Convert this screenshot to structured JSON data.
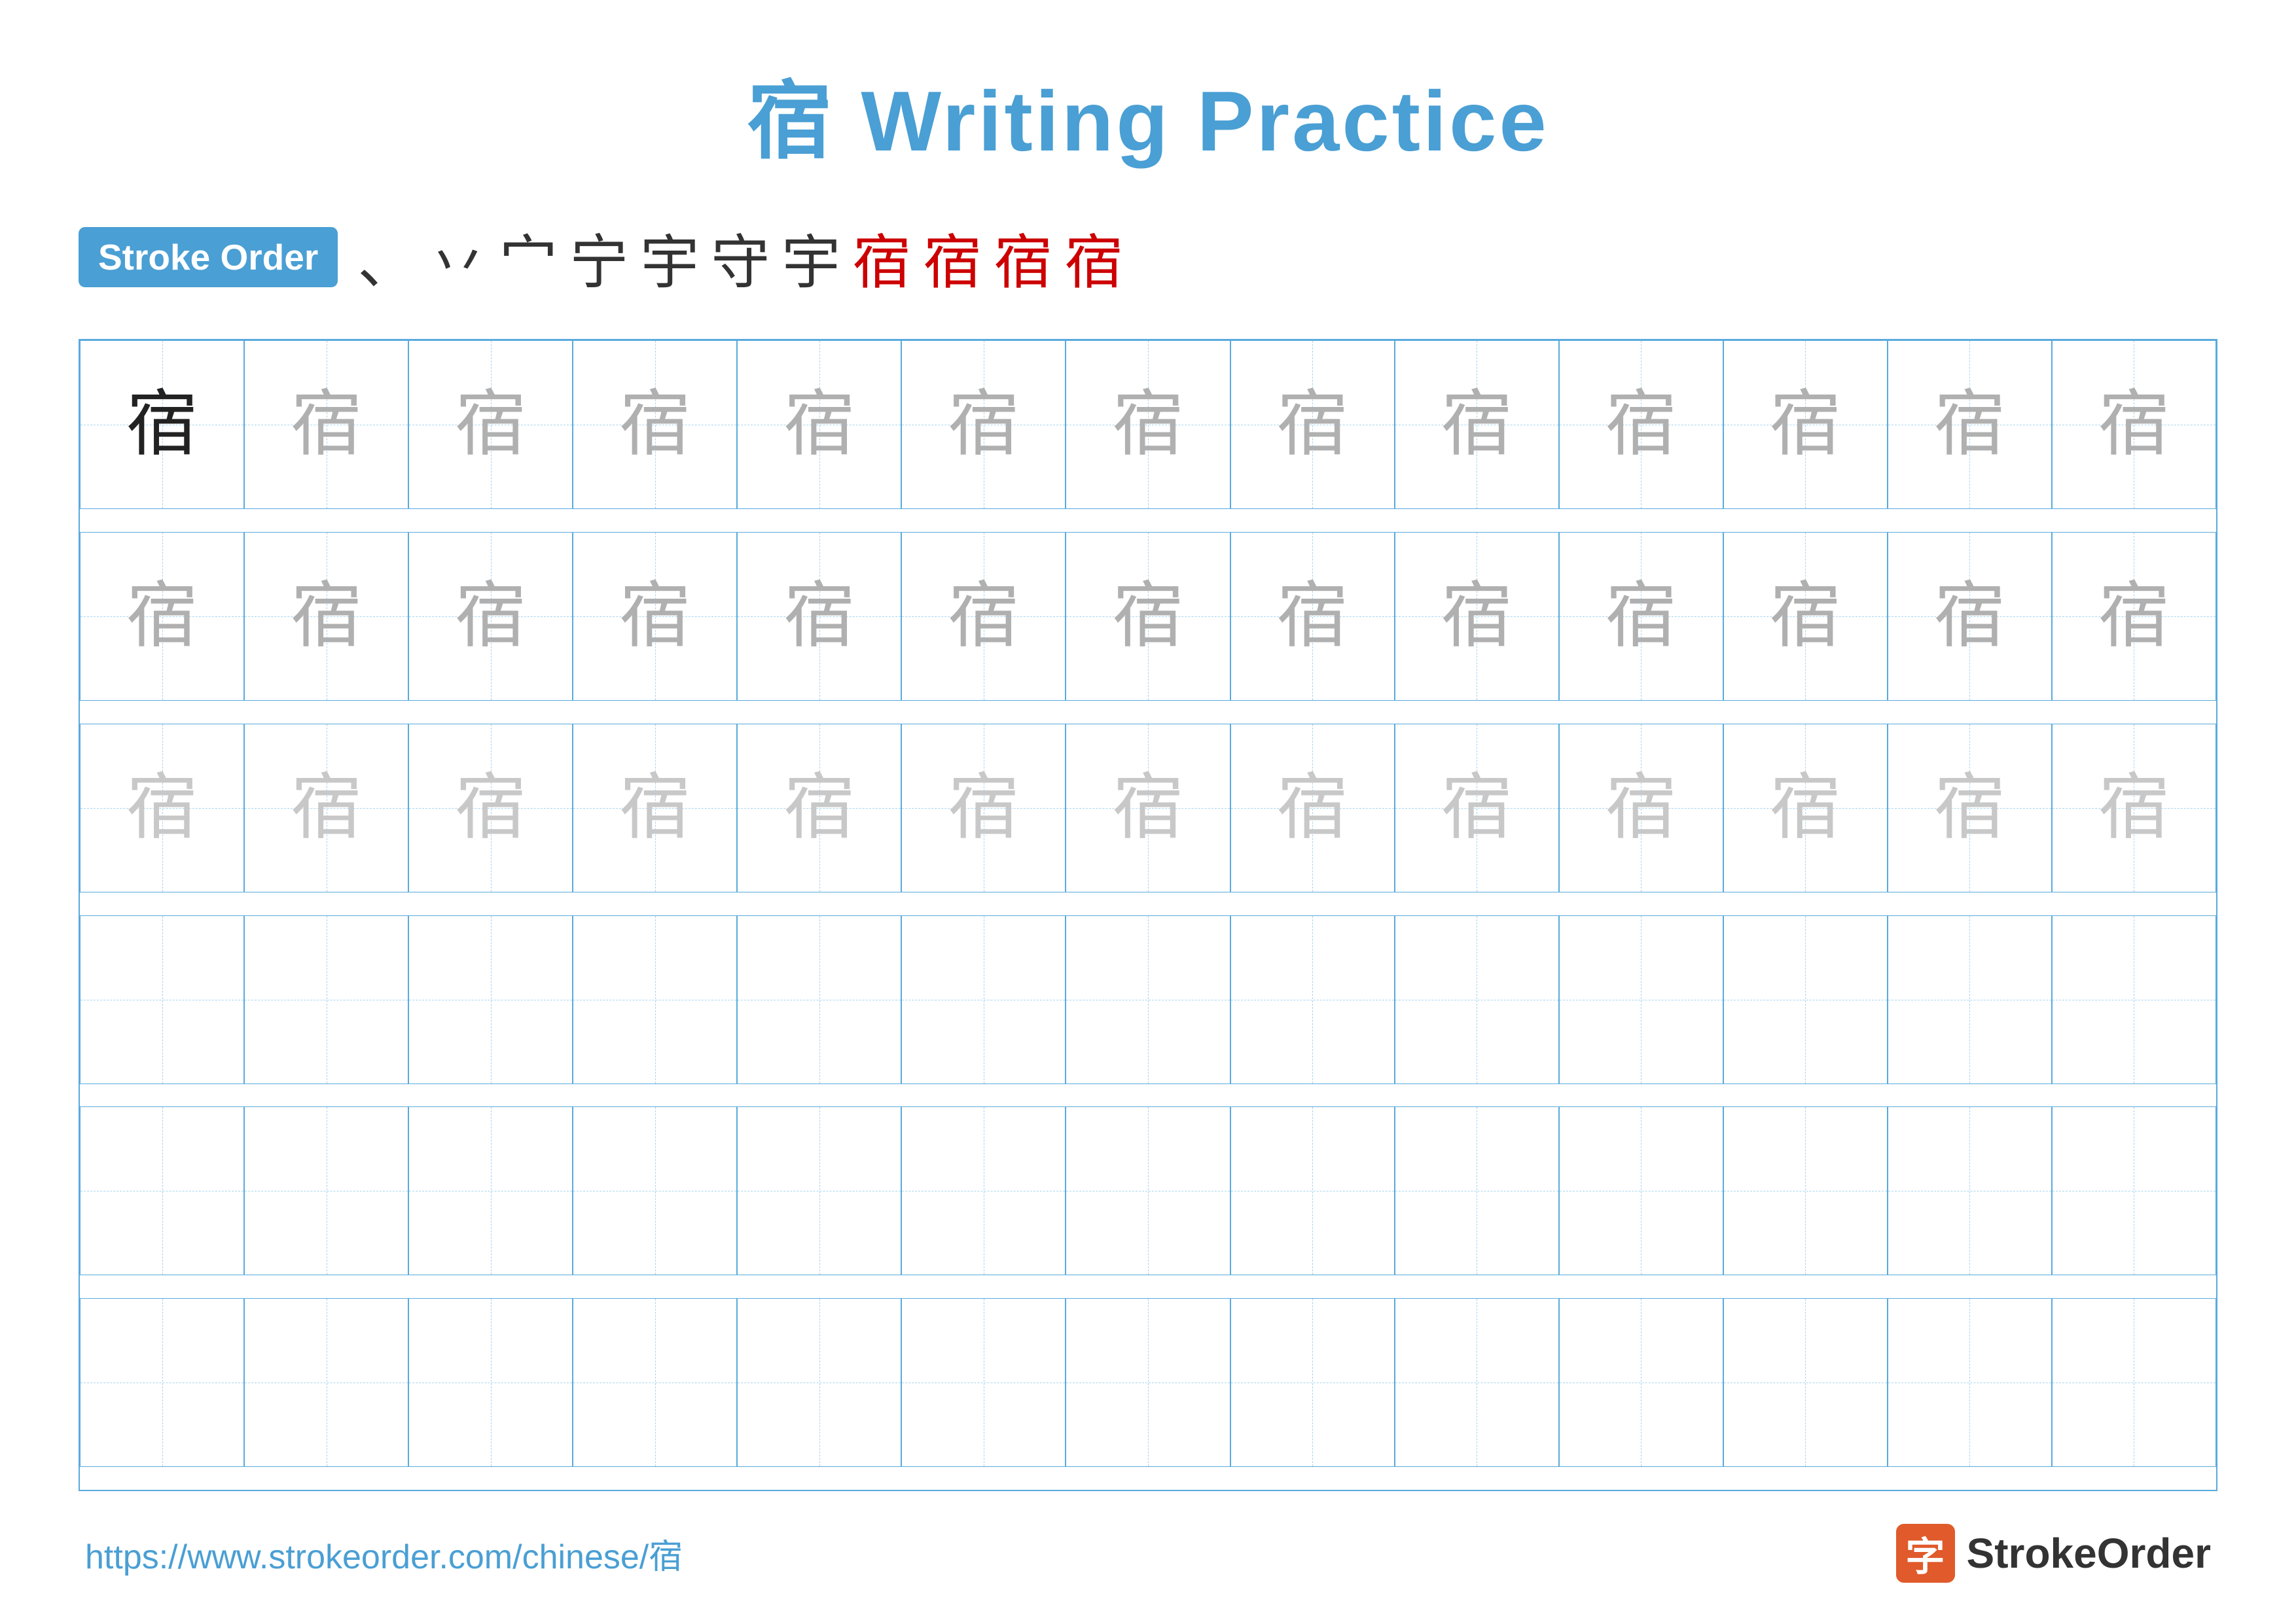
{
  "title": "宿 Writing Practice",
  "stroke_order_badge": "Stroke Order",
  "stroke_sequence": [
    "、",
    "丷",
    "宀",
    "宁",
    "宇",
    "守",
    "宇",
    "宿",
    "宿",
    "宿",
    "宿"
  ],
  "character": "宿",
  "grid": {
    "rows": 6,
    "cols": 13,
    "chars_row1": [
      "dark",
      "light1",
      "light1",
      "light1",
      "light1",
      "light1",
      "light1",
      "light1",
      "light1",
      "light1",
      "light1",
      "light1",
      "light1"
    ],
    "chars_row2": [
      "light1",
      "light1",
      "light1",
      "light1",
      "light1",
      "light1",
      "light1",
      "light1",
      "light1",
      "light1",
      "light1",
      "light1",
      "light1"
    ],
    "chars_row3": [
      "light2",
      "light2",
      "light2",
      "light2",
      "light2",
      "light2",
      "light2",
      "light2",
      "light2",
      "light2",
      "light2",
      "light2",
      "light2"
    ],
    "chars_row4": [
      "",
      "",
      "",
      "",
      "",
      "",
      "",
      "",
      "",
      "",
      "",
      "",
      ""
    ],
    "chars_row5": [
      "",
      "",
      "",
      "",
      "",
      "",
      "",
      "",
      "",
      "",
      "",
      "",
      ""
    ],
    "chars_row6": [
      "",
      "",
      "",
      "",
      "",
      "",
      "",
      "",
      "",
      "",
      "",
      "",
      ""
    ]
  },
  "footer": {
    "url": "https://www.strokeorder.com/chinese/宿",
    "brand_name": "StrokeOrder",
    "brand_icon_char": "字"
  }
}
